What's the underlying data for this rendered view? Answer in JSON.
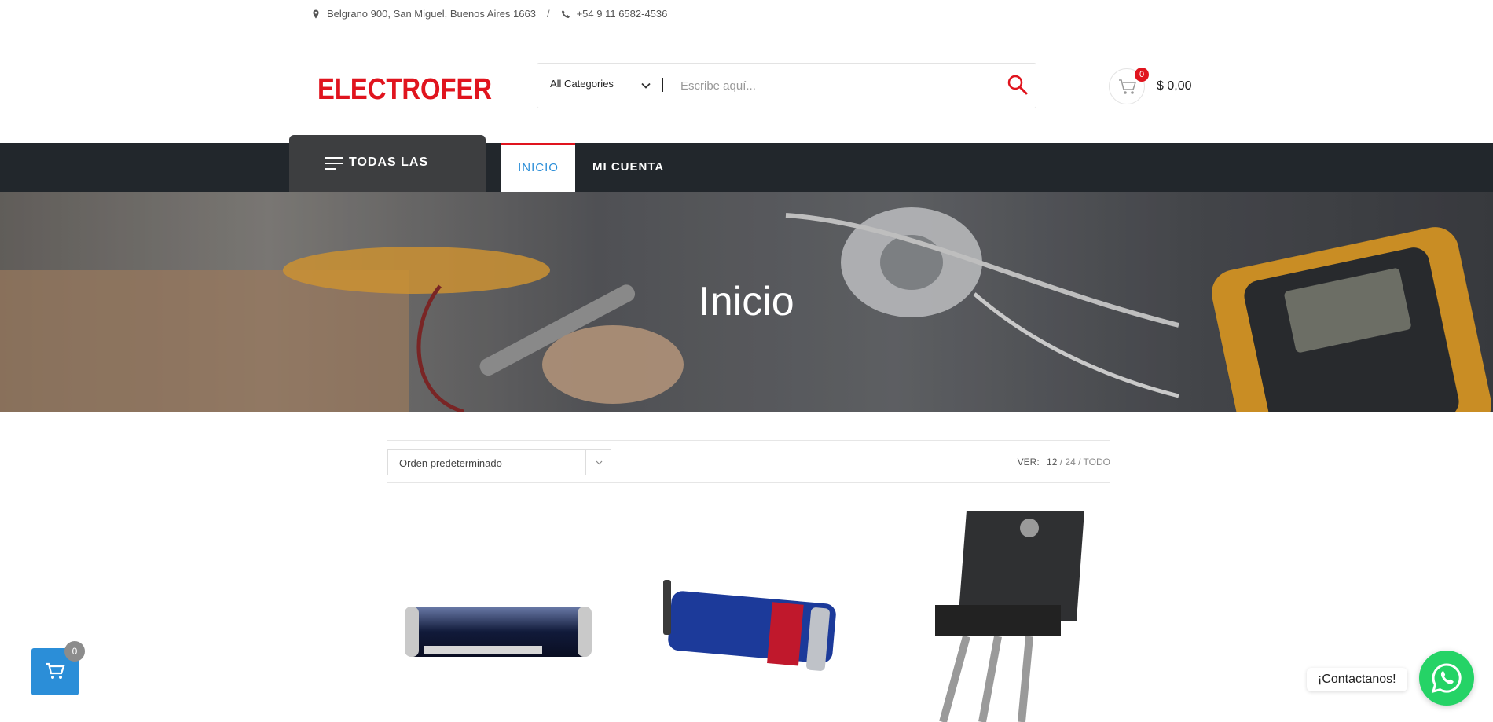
{
  "topbar": {
    "address": "Belgrano 900, San Miguel, Buenos Aires 1663",
    "separator": "/",
    "phone": "+54 9 11 6582-4536"
  },
  "header": {
    "logo_text": "ELECTROFER",
    "category_select": "All Categories",
    "search_placeholder": "Escribe aquí...",
    "cart_count": "0",
    "cart_total": "$ 0,00"
  },
  "nav": {
    "all_categories": "TODAS LAS",
    "items": [
      {
        "label": "INICIO"
      },
      {
        "label": "MI CUENTA"
      }
    ]
  },
  "hero": {
    "title": "Inicio"
  },
  "shop": {
    "sort_value": "Orden predeterminado",
    "ver_label": "VER:",
    "ver_options": [
      "12",
      "24",
      "TODO"
    ]
  },
  "floating": {
    "cart_count": "0",
    "contact_label": "¡Contactanos!"
  },
  "colors": {
    "brand_red": "#e0141e",
    "nav_dark": "#22272c",
    "accent_blue": "#2b8ed8",
    "whatsapp_green": "#25d366"
  }
}
